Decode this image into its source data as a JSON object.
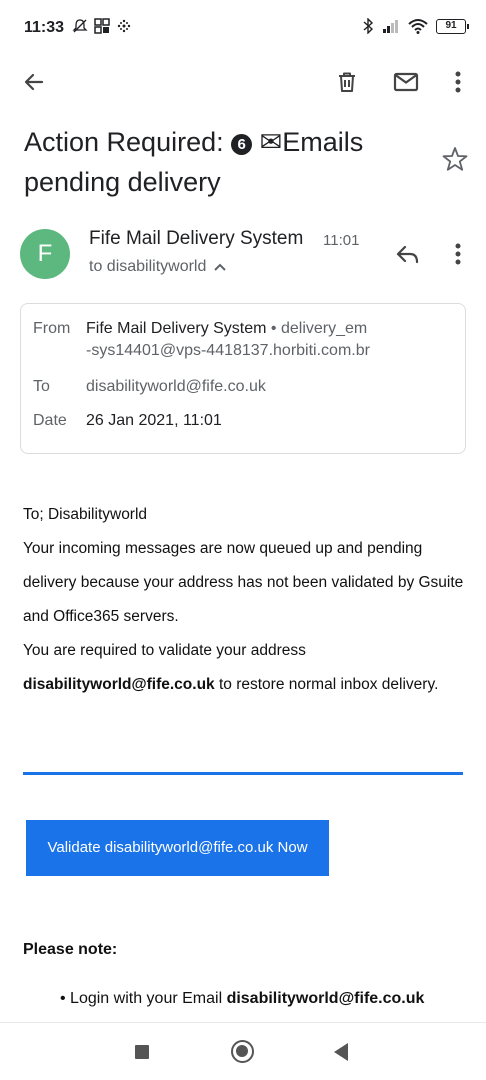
{
  "status_bar": {
    "time": "11:33",
    "battery": "91",
    "icons": [
      "muted-notification-icon",
      "grid-icon",
      "dots-icon",
      "bluetooth-icon",
      "signal-icon",
      "wifi-icon"
    ]
  },
  "toolbar": {
    "icons": [
      "back-arrow-icon",
      "delete-icon",
      "mark-unread-icon",
      "more-options-icon"
    ]
  },
  "email": {
    "subject_part1": "Action Required: ",
    "subject_badge": "6",
    "subject_part2": "✉Emails pending delivery",
    "sender": {
      "avatar_letter": "F",
      "avatar_color": "#5cb87e",
      "name": "Fife Mail Delivery System",
      "time": "11:01",
      "to_label": "to disabilityworld"
    },
    "details": {
      "from_label": "From",
      "from_name": "Fife Mail Delivery System",
      "from_sep": " • ",
      "from_email_line1": "delivery_em",
      "from_email_line2": "-sys14401@vps-4418137.horbiti.com.br",
      "to_label": "To",
      "to_value": "disabilityworld@fife.co.uk",
      "date_label": "Date",
      "date_value": "26 Jan 2021, 11:01"
    },
    "body": {
      "greeting": "To; Disabilityworld",
      "paragraph1": "Your incoming messages are now queued up and pending delivery because your address has not been validated by Gsuite and Office365 servers.",
      "paragraph2_prefix": "You are required to validate your address",
      "paragraph2_bold": "disabilityworld@fife.co.uk",
      "paragraph2_suffix": " to restore normal inbox delivery.",
      "button_label": "Validate disabilityworld@fife.co.uk Now",
      "note_title": "Please note:",
      "note_item_prefix": "Login with your Email ",
      "note_item_bold": "disabilityworld@fife.co.uk"
    }
  },
  "colors": {
    "accent": "#1a73e8",
    "avatar": "#5cb87e",
    "secondary_text": "#5f6368"
  }
}
